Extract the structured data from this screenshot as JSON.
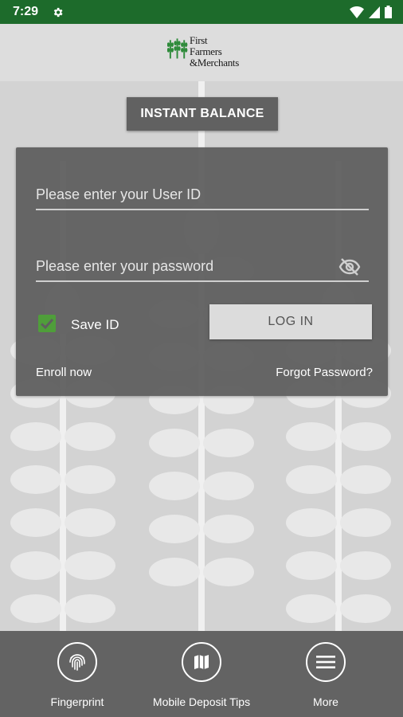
{
  "status_bar": {
    "time": "7:29"
  },
  "header": {
    "logo_lines": [
      "First",
      "Farmers",
      "&Merchants"
    ]
  },
  "main": {
    "instant_balance_label": "INSTANT BALANCE",
    "login": {
      "user_id_placeholder": "Please enter your User ID",
      "password_placeholder": "Please enter your password",
      "save_id_label": "Save ID",
      "save_id_checked": true,
      "login_button_label": "LOG IN",
      "enroll_label": "Enroll now",
      "forgot_password_label": "Forgot Password?"
    }
  },
  "bottom_nav": {
    "items": [
      {
        "label": "Fingerprint",
        "icon": "fingerprint-icon"
      },
      {
        "label": "Mobile Deposit Tips",
        "icon": "map-icon"
      },
      {
        "label": "More",
        "icon": "menu-icon"
      }
    ]
  },
  "colors": {
    "status_bar": "#1d6b2b",
    "accent_green": "#4f9e3a",
    "card": "#5f5f5f",
    "bottom_nav": "#636363"
  }
}
